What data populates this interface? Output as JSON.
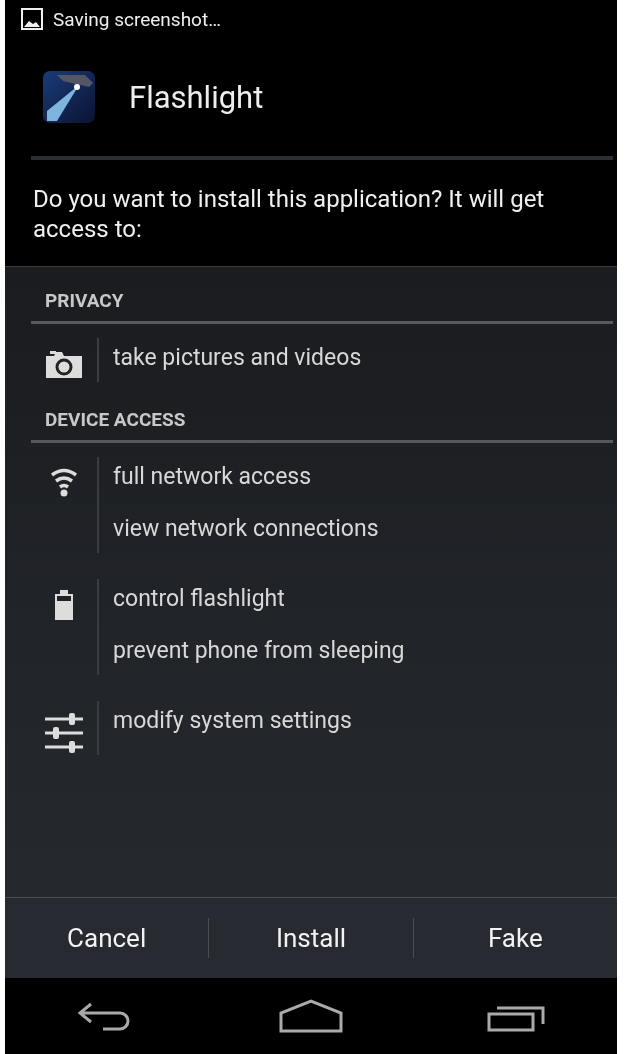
{
  "status_bar": {
    "notification": "Saving screenshot…"
  },
  "app": {
    "name": "Flashlight"
  },
  "prompt": "Do you want to install this application? It will get access to:",
  "sections": [
    {
      "title": "PRIVACY",
      "groups": [
        {
          "kind": "camera",
          "permissions": [
            "take pictures and videos"
          ]
        }
      ]
    },
    {
      "title": "DEVICE ACCESS",
      "groups": [
        {
          "kind": "wifi",
          "permissions": [
            "full network access",
            "view network connections"
          ]
        },
        {
          "kind": "battery",
          "permissions": [
            "control flashlight",
            "prevent phone from sleeping"
          ]
        },
        {
          "kind": "sliders",
          "permissions": [
            "modify system settings"
          ]
        }
      ]
    }
  ],
  "buttons": [
    "Cancel",
    "Install",
    "Fake"
  ]
}
